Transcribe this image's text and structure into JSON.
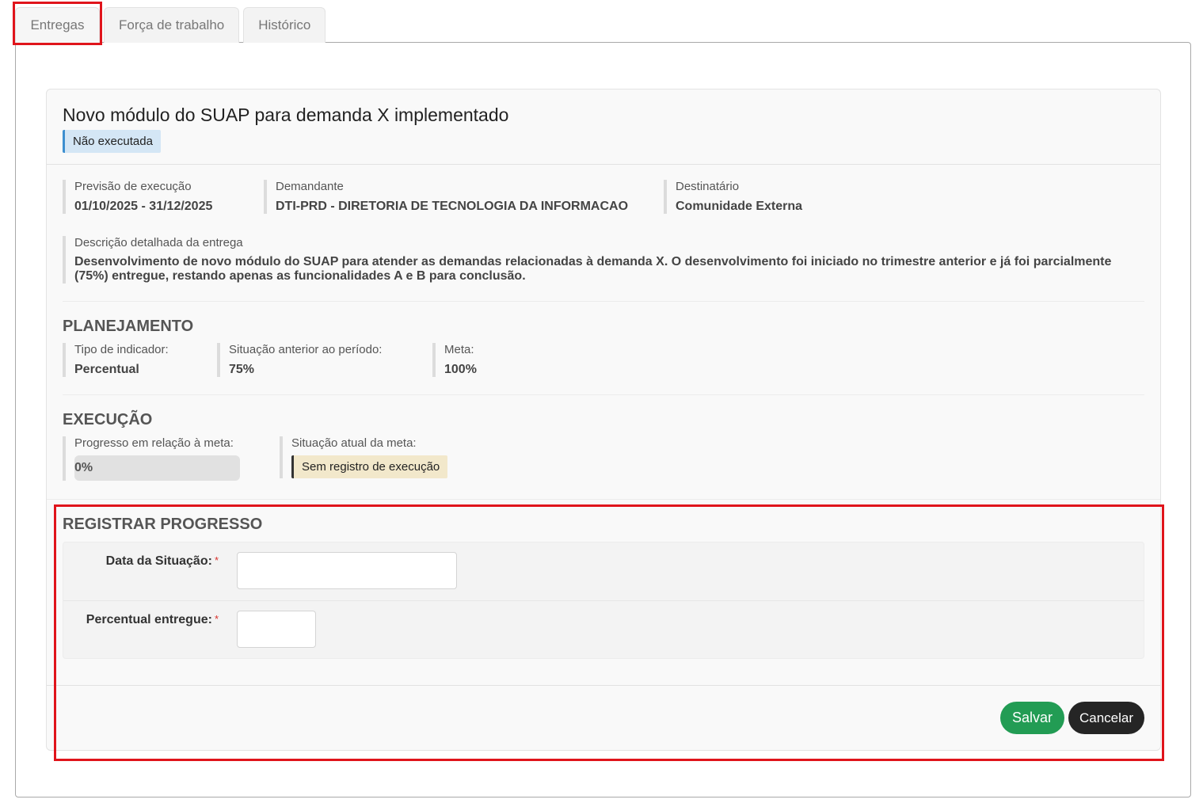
{
  "tabs": [
    {
      "label": "Entregas",
      "active": true
    },
    {
      "label": "Força de trabalho",
      "active": false
    },
    {
      "label": "Histórico",
      "active": false
    }
  ],
  "delivery": {
    "title": "Novo módulo do SUAP para demanda X implementado",
    "status": "Não executada",
    "forecast_label": "Previsão de execução",
    "forecast_value": "01/10/2025 - 31/12/2025",
    "requester_label": "Demandante",
    "requester_value": "DTI-PRD - DIRETORIA DE TECNOLOGIA DA INFORMACAO",
    "recipient_label": "Destinatário",
    "recipient_value": "Comunidade Externa",
    "description_label": "Descrição detalhada da entrega",
    "description_value": "Desenvolvimento de novo módulo do SUAP para atender as demandas relacionadas à demanda X. O desenvolvimento foi iniciado no trimestre anterior e já foi parcialmente (75%) entregue, restando apenas as funcionalidades A e B para conclusão."
  },
  "planning": {
    "title": "PLANEJAMENTO",
    "indicator_label": "Tipo de indicador:",
    "indicator_value": "Percentual",
    "previous_label": "Situação anterior ao período:",
    "previous_value": "75%",
    "goal_label": "Meta:",
    "goal_value": "100%"
  },
  "execution": {
    "title": "EXECUÇÃO",
    "progress_label": "Progresso em relação à meta:",
    "progress_text": "0%",
    "progress_fraction": 0,
    "current_label": "Situação atual da meta:",
    "current_value": "Sem registro de execução"
  },
  "register": {
    "title": "REGISTRAR PROGRESSO",
    "date_label": "Data da Situação:",
    "date_value": "",
    "percent_label": "Percentual entregue:",
    "percent_value": "",
    "required_mark": "*",
    "save_label": "Salvar",
    "cancel_label": "Cancelar"
  },
  "colors": {
    "save": "#229c54",
    "cancel": "#252525",
    "highlight": "#e0141b"
  }
}
